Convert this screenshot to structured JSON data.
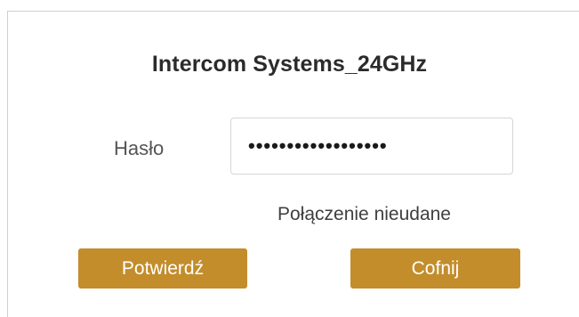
{
  "dialog": {
    "title": "Intercom Systems_24GHz",
    "password": {
      "label": "Hasło",
      "value": "••••••••••••••••••"
    },
    "status_message": "Połączenie nieudane",
    "buttons": {
      "confirm_label": "Potwierdź",
      "back_label": "Cofnij"
    }
  },
  "colors": {
    "button_background": "#c38d2c",
    "button_text": "#ffffff",
    "title_text": "#2b2b2b",
    "input_border": "#d6d6d6"
  }
}
